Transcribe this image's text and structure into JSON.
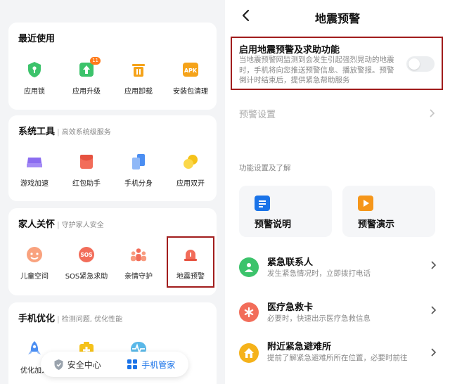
{
  "left": {
    "recent": {
      "title": "最近使用",
      "items": [
        {
          "label": "应用锁",
          "icon": "app-lock-icon"
        },
        {
          "label": "应用升级",
          "icon": "app-upgrade-icon",
          "badge": "11"
        },
        {
          "label": "应用卸载",
          "icon": "app-uninstall-icon"
        },
        {
          "label": "安装包清理",
          "icon": "apk-clean-icon",
          "icon_text": "APK"
        }
      ]
    },
    "system": {
      "title": "系统工具",
      "subtitle": "高效系统级服务",
      "items": [
        {
          "label": "游戏加速",
          "icon": "game-boost-icon"
        },
        {
          "label": "红包助手",
          "icon": "red-envelope-icon"
        },
        {
          "label": "手机分身",
          "icon": "phone-clone-icon"
        },
        {
          "label": "应用双开",
          "icon": "dual-app-icon"
        }
      ]
    },
    "family": {
      "title": "家人关怀",
      "subtitle": "守护家人安全",
      "items": [
        {
          "label": "儿童空间",
          "icon": "kids-space-icon"
        },
        {
          "label": "SOS紧急求助",
          "icon": "sos-icon",
          "icon_text": "SOS"
        },
        {
          "label": "亲情守护",
          "icon": "family-guard-icon"
        },
        {
          "label": "地震预警",
          "icon": "earthquake-alarm-icon"
        }
      ]
    },
    "optimize": {
      "title": "手机优化",
      "subtitle": "检测问题, 优化性能",
      "items": [
        {
          "label": "优化加速",
          "icon": "rocket-icon"
        },
        {
          "label": "",
          "icon": "first-aid-icon"
        },
        {
          "label": "",
          "icon": "pulse-icon"
        }
      ]
    },
    "bottom_bar": {
      "security_center": "安全中心",
      "phone_manager": "手机管家"
    }
  },
  "right": {
    "title": "地震预警",
    "toggle": {
      "title": "启用地震预警及求助功能",
      "description": "当地震预警网监测到会发生引起强烈晃动的地震时，手机将向您推送预警信息、播放警报。预警倒计时结束后，提供紧急帮助服务",
      "enabled": false
    },
    "alert_settings": "预警设置",
    "section_label": "功能设置及了解",
    "cards": [
      {
        "label": "预警说明",
        "icon": "document-icon"
      },
      {
        "label": "预警演示",
        "icon": "play-icon"
      }
    ],
    "list": [
      {
        "title": "紧急联系人",
        "subtitle": "发生紧急情况时，立即拨打电话",
        "icon": "contact-icon"
      },
      {
        "title": "医疗急救卡",
        "subtitle": "必要时，快速出示医疗急救信息",
        "icon": "medical-card-icon"
      },
      {
        "title": "附近紧急避难所",
        "subtitle": "提前了解紧急避难所所在位置，必要时前往",
        "icon": "shelter-icon"
      }
    ]
  },
  "colors": {
    "accent_blue": "#1a73e8",
    "highlight_red": "#a11d1d",
    "green": "#3cc36b",
    "coral": "#f26d5a",
    "orange": "#f5a31a"
  }
}
